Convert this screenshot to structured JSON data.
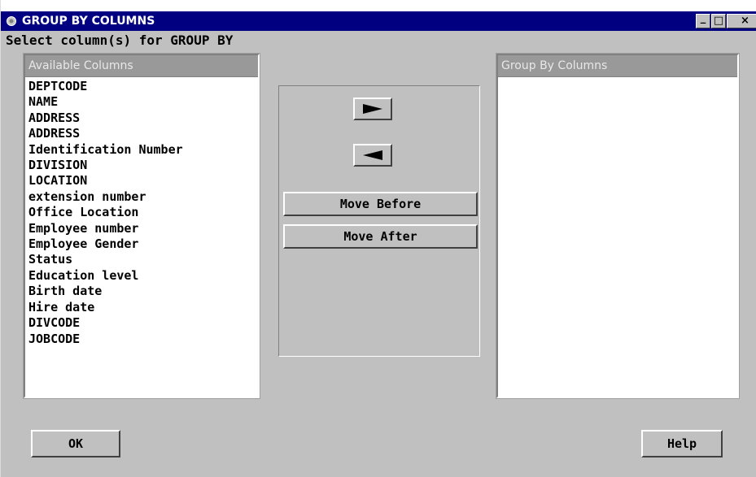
{
  "window": {
    "title": "GROUP BY COLUMNS",
    "minimize_label": "_",
    "maximize_label": "□",
    "close_label": "×"
  },
  "prompt": "Select column(s) for GROUP BY",
  "available": {
    "header": "Available Columns",
    "items": [
      "DEPTCODE",
      "NAME",
      "ADDRESS",
      "ADDRESS",
      "Identification Number",
      "DIVISION",
      "LOCATION",
      "extension number",
      "Office Location",
      "Employee number",
      "Employee Gender",
      "Status",
      "Education level",
      "Birth date",
      "Hire date",
      "DIVCODE",
      "JOBCODE"
    ]
  },
  "group_by": {
    "header": "Group By Columns",
    "items": []
  },
  "buttons": {
    "move_before": "Move Before",
    "move_after": "Move After",
    "ok": "OK",
    "help": "Help",
    "add_icon": "right-arrow-icon",
    "remove_icon": "left-arrow-icon"
  },
  "colors": {
    "title_bar": "#000080",
    "background": "#c0c0c0",
    "list_header": "#999999"
  }
}
